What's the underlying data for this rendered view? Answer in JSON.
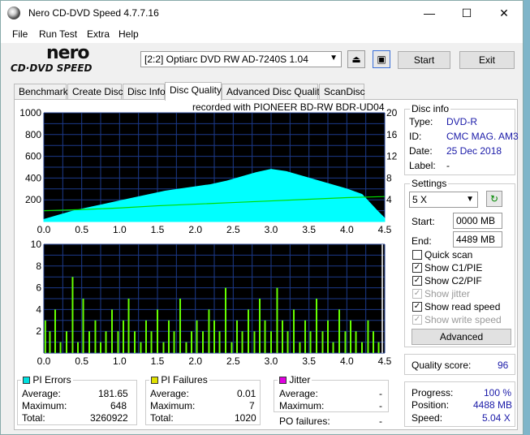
{
  "window": {
    "title": "Nero CD-DVD Speed 4.7.7.16",
    "min_glyph": "—",
    "max_glyph": "☐",
    "close_glyph": "✕"
  },
  "menu": [
    "File",
    "Run Test",
    "Extra",
    "Help"
  ],
  "logo": {
    "line1": "nero",
    "line2": "CD·DVD SPEED"
  },
  "toolbar": {
    "drive": "[2:2]  Optiarc DVD RW AD-7240S 1.04",
    "start_label": "Start",
    "exit_label": "Exit"
  },
  "tabs": [
    "Benchmark",
    "Create Disc",
    "Disc Info",
    "Disc Quality",
    "Advanced Disc Quality",
    "ScanDisc"
  ],
  "active_tab": "Disc Quality",
  "recorded_with": "recorded with PIONEER  BD-RW   BDR-UD04",
  "disc_info": {
    "title": "Disc info",
    "rows": [
      {
        "label": "Type:",
        "value": "DVD-R"
      },
      {
        "label": "ID:",
        "value": "CMC MAG. AM3"
      },
      {
        "label": "Date:",
        "value": "25 Dec 2018"
      },
      {
        "label": "Label:",
        "value": "-"
      }
    ]
  },
  "settings": {
    "title": "Settings",
    "speed": "5 X",
    "start_label": "Start:",
    "start_value": "0000 MB",
    "end_label": "End:",
    "end_value": "4489 MB",
    "checks": [
      {
        "label": "Quick scan",
        "checked": false,
        "disabled": false
      },
      {
        "label": "Show C1/PIE",
        "checked": true,
        "disabled": false
      },
      {
        "label": "Show C2/PIF",
        "checked": true,
        "disabled": false
      },
      {
        "label": "Show jitter",
        "checked": true,
        "disabled": true
      },
      {
        "label": "Show read speed",
        "checked": true,
        "disabled": false
      },
      {
        "label": "Show write speed",
        "checked": true,
        "disabled": true
      }
    ],
    "advanced_label": "Advanced"
  },
  "quality": {
    "label": "Quality score:",
    "value": "96"
  },
  "progress": {
    "rows": [
      {
        "label": "Progress:",
        "value": "100 %"
      },
      {
        "label": "Position:",
        "value": "4488 MB"
      },
      {
        "label": "Speed:",
        "value": "5.04 X"
      }
    ]
  },
  "pi_errors": {
    "title": "PI Errors",
    "color": "#00e0e0",
    "rows": [
      {
        "label": "Average:",
        "value": "181.65"
      },
      {
        "label": "Maximum:",
        "value": "648"
      },
      {
        "label": "Total:",
        "value": "3260922"
      }
    ]
  },
  "pi_failures": {
    "title": "PI Failures",
    "color": "#e0e000",
    "rows": [
      {
        "label": "Average:",
        "value": "0.01"
      },
      {
        "label": "Maximum:",
        "value": "7"
      },
      {
        "label": "Total:",
        "value": "1020"
      }
    ]
  },
  "jitter": {
    "title": "Jitter",
    "color": "#e000e0",
    "rows": [
      {
        "label": "Average:",
        "value": "-"
      },
      {
        "label": "Maximum:",
        "value": "-"
      }
    ],
    "po_label": "PO failures:",
    "po_value": "-"
  },
  "chart_data": [
    {
      "type": "area",
      "x_ticks": [
        "0.0",
        "0.5",
        "1.0",
        "1.5",
        "2.0",
        "2.5",
        "3.0",
        "3.5",
        "4.0",
        "4.5"
      ],
      "y_left_ticks": [
        "1000",
        "800",
        "600",
        "400",
        "200"
      ],
      "y_right_ticks": [
        "20",
        "16",
        "12",
        "8",
        "4"
      ],
      "xlim": [
        0,
        4.5
      ],
      "ylim": [
        0,
        1000
      ],
      "y2lim": [
        0,
        20
      ],
      "grid": true,
      "series": [
        {
          "kind": "PI Errors",
          "color": "#00ffff",
          "x": [
            0.0,
            0.2,
            0.4,
            0.6,
            0.8,
            1.0,
            1.2,
            1.4,
            1.6,
            1.8,
            2.0,
            2.2,
            2.4,
            2.6,
            2.8,
            3.0,
            3.2,
            3.4,
            3.6,
            3.8,
            4.0,
            4.2,
            4.4,
            4.5
          ],
          "y": [
            20,
            60,
            100,
            130,
            160,
            190,
            220,
            250,
            280,
            300,
            320,
            340,
            370,
            410,
            450,
            480,
            460,
            420,
            380,
            340,
            300,
            250,
            100,
            30
          ]
        },
        {
          "kind": "read speed",
          "color": "#00dd00",
          "x": [
            0.0,
            0.5,
            1.0,
            1.5,
            2.0,
            2.5,
            3.0,
            3.5,
            4.0,
            4.5
          ],
          "y": [
            2.0,
            2.2,
            2.5,
            2.9,
            3.2,
            3.5,
            3.8,
            4.1,
            4.4,
            4.6
          ]
        }
      ]
    },
    {
      "type": "bar",
      "x_ticks": [
        "0.0",
        "0.5",
        "1.0",
        "1.5",
        "2.0",
        "2.5",
        "3.0",
        "3.5",
        "4.0",
        "4.5"
      ],
      "y_ticks": [
        "10",
        "8",
        "6",
        "4",
        "2"
      ],
      "xlim": [
        0,
        4.5
      ],
      "ylim": [
        0,
        10
      ],
      "grid": true,
      "series": [
        {
          "kind": "PI Failures",
          "color": "#66ff00",
          "x": [
            0.02,
            0.08,
            0.15,
            0.22,
            0.3,
            0.38,
            0.45,
            0.52,
            0.6,
            0.68,
            0.75,
            0.82,
            0.9,
            0.98,
            1.05,
            1.12,
            1.2,
            1.28,
            1.35,
            1.42,
            1.5,
            1.58,
            1.65,
            1.72,
            1.8,
            1.88,
            1.95,
            2.02,
            2.1,
            2.18,
            2.25,
            2.32,
            2.4,
            2.48,
            2.55,
            2.62,
            2.7,
            2.78,
            2.85,
            2.92,
            3.0,
            3.08,
            3.15,
            3.22,
            3.3,
            3.38,
            3.45,
            3.52,
            3.6,
            3.68,
            3.75,
            3.82,
            3.9,
            3.98,
            4.05,
            4.12,
            4.2,
            4.28,
            4.35,
            4.42
          ],
          "y": [
            3,
            2,
            4,
            1,
            2,
            7,
            1,
            5,
            2,
            3,
            1,
            2,
            4,
            2,
            3,
            5,
            2,
            1,
            3,
            2,
            4,
            1,
            3,
            2,
            5,
            1,
            2,
            3,
            2,
            4,
            3,
            2,
            6,
            1,
            3,
            2,
            4,
            2,
            5,
            3,
            2,
            6,
            3,
            2,
            4,
            1,
            3,
            2,
            5,
            2,
            3,
            1,
            4,
            2,
            3,
            2,
            1,
            3,
            2,
            1
          ]
        }
      ]
    }
  ]
}
